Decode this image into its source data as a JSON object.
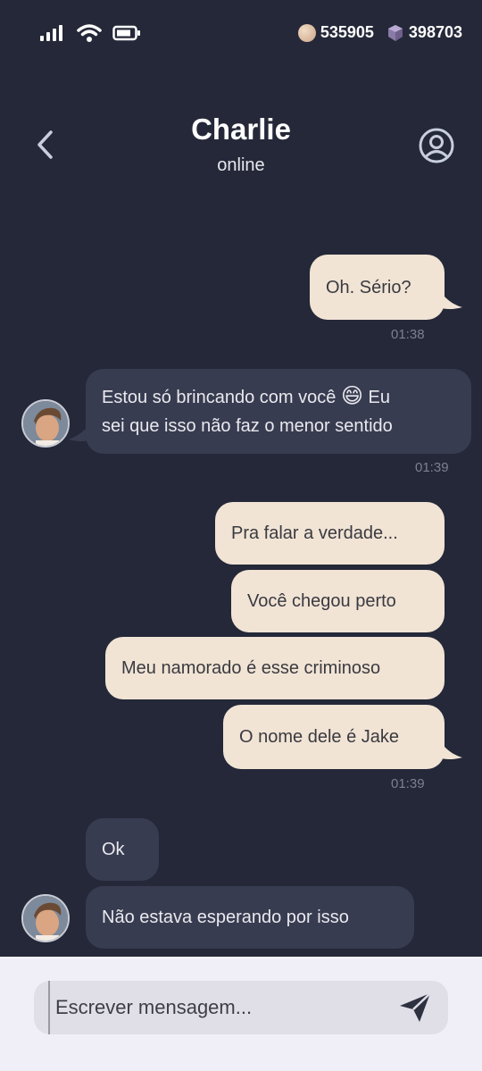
{
  "status_bar": {
    "coins": "535905",
    "gems": "398703"
  },
  "header": {
    "name": "Charlie",
    "status": "online"
  },
  "messages": [
    {
      "text": "Oh. Sério?"
    },
    {
      "time": "01:38"
    },
    {
      "text_before_emoji": "Estou só brincando com você",
      "emoji": "😄",
      "text_after_emoji": "Eu",
      "line2": "sei que isso não faz o menor sentido"
    },
    {
      "time": "01:39"
    },
    {
      "text": "Pra falar a verdade..."
    },
    {
      "text": "Você chegou perto"
    },
    {
      "text": "Meu namorado é esse criminoso"
    },
    {
      "text": "O nome dele é Jake"
    },
    {
      "time": "01:39"
    },
    {
      "text": "Ok"
    },
    {
      "text": "Não estava esperando por isso"
    }
  ],
  "composer": {
    "placeholder": "Escrever mensagem..."
  },
  "icons": {
    "signal": "signal-icon",
    "wifi": "wifi-icon",
    "battery": "battery-icon",
    "coin": "coin-icon",
    "gem": "gem-icon",
    "back": "chevron-left-icon",
    "profile": "user-circle-icon",
    "send": "send-icon"
  },
  "colors": {
    "background": "#242838",
    "outgoing_bubble": "#f1e4d5",
    "incoming_bubble": "#383c50",
    "composer_bg": "#f0eff8"
  }
}
